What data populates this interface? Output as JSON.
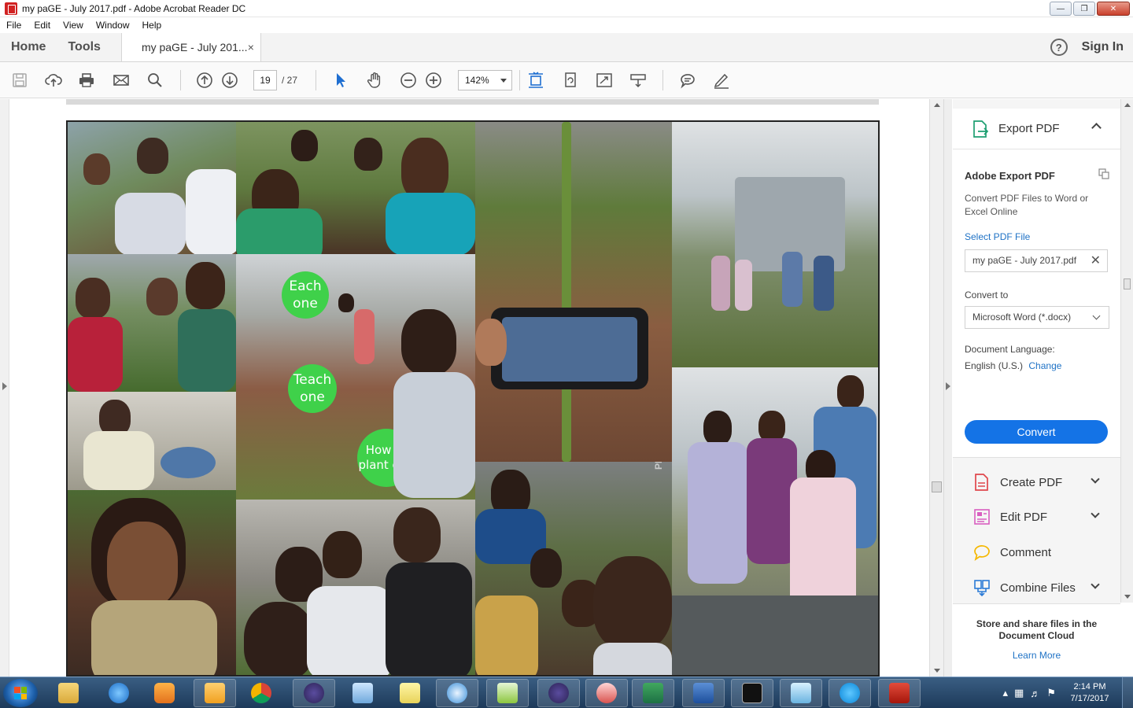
{
  "window": {
    "title": "my paGE - July 2017.pdf - Adobe Acrobat Reader DC"
  },
  "menu": [
    "File",
    "Edit",
    "View",
    "Window",
    "Help"
  ],
  "tabs": {
    "home": "Home",
    "tools": "Tools",
    "document": "my paGE - July 201...",
    "close": "×"
  },
  "header": {
    "help": "?",
    "sign_in": "Sign In"
  },
  "toolbar": {
    "page_current": "19",
    "page_total": "/ 27",
    "zoom": "142%"
  },
  "document": {
    "bubble_1": "Each one",
    "bubble_2": "Teach one",
    "bubble_3": "How to plant one",
    "watermark": "PICSART"
  },
  "right_pane": {
    "export_header": "Export PDF",
    "export_title": "Adobe Export PDF",
    "export_desc": "Convert PDF Files to Word or Excel Online",
    "select_label": "Select PDF File",
    "selected_file": "my paGE - July 2017.pdf",
    "convert_to_label": "Convert to",
    "convert_to_value": "Microsoft Word (*.docx)",
    "language_label": "Document Language:",
    "language_value": "English (U.S.)",
    "change_link": "Change",
    "convert_button": "Convert",
    "tools": [
      {
        "label": "Create PDF",
        "icon": "create-pdf-icon",
        "color": "#e0474c"
      },
      {
        "label": "Edit PDF",
        "icon": "edit-pdf-icon",
        "color": "#d95ec0"
      },
      {
        "label": "Comment",
        "icon": "comment-icon",
        "color": "#f5b800"
      },
      {
        "label": "Combine Files",
        "icon": "combine-files-icon",
        "color": "#2b7bd6"
      }
    ],
    "cloud_text": "Store and share files in the Document Cloud",
    "learn_more": "Learn More"
  },
  "taskbar": {
    "time": "2:14 PM",
    "date": "7/17/2017"
  }
}
